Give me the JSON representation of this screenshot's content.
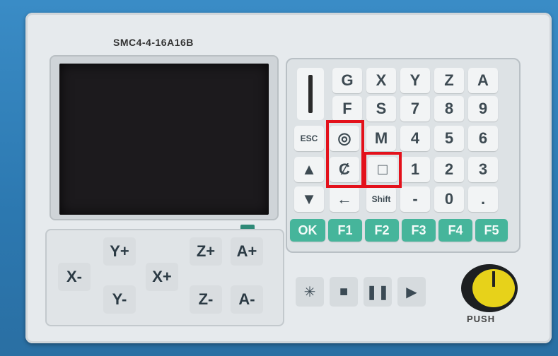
{
  "device": {
    "model": "SMC4-4-16A16B"
  },
  "keys": {
    "row1": [
      "G",
      "X",
      "Y",
      "Z",
      "A"
    ],
    "row2": [
      "F",
      "S",
      "7",
      "8",
      "9"
    ],
    "row3": [
      "ESC",
      "◎",
      "M",
      "4",
      "5",
      "6"
    ],
    "row4": [
      "▲",
      "Ȼ",
      "□",
      "1",
      "2",
      "3"
    ],
    "row5": [
      "▼",
      "←",
      "Shift",
      "-",
      "0",
      "."
    ],
    "fkeys": [
      "OK",
      "F1",
      "F2",
      "F3",
      "F4",
      "F5"
    ]
  },
  "jog": [
    "X-",
    "Y+",
    "Y-",
    "X+",
    "Z+",
    "Z-",
    "A+",
    "A-"
  ],
  "playback": [
    "✳",
    "■",
    "❚❚",
    "▶"
  ],
  "knob_label": "PUSH",
  "colors": {
    "highlight": "#e3111b",
    "function_key": "#46b59b"
  }
}
